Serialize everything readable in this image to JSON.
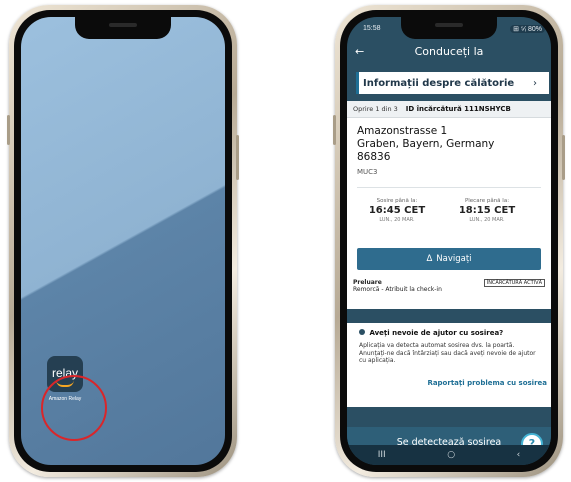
{
  "left_phone": {
    "app": {
      "icon_text": "relay",
      "label": "Amazon Relay",
      "icon_color": "#253f52",
      "accent_color": "#f5a623"
    },
    "highlight_color": "#d9262a"
  },
  "right_phone": {
    "status": {
      "time": "15:58",
      "icons": "⊞ ⁵⁄ᵢ 80%"
    },
    "header": {
      "back_icon": "←",
      "title": "Conduceți la"
    },
    "trip_info": {
      "label": "Informații despre călătorie",
      "chevron": "›"
    },
    "stop": {
      "counter": "Oprire 1 din 3",
      "load_id": "ID încărcătură 111NSHYCB",
      "address_line1": "Amazonstrasse 1",
      "address_line2": "Graben, Bayern, Germany",
      "postal": "86836",
      "facility": "MUC3"
    },
    "arrival": {
      "label": "Sosire până la:",
      "time": "16:45 CET",
      "date": "LUN., 20 MAR."
    },
    "departure": {
      "label": "Plecare până la:",
      "time": "18:15 CET",
      "date": "LUN., 20 MAR."
    },
    "navigate_button": {
      "icon": "Δ",
      "label": "Navigați"
    },
    "pickup": {
      "title": "Preluare",
      "detail": "Remorcă - Atribuit la check-in",
      "badge": "ÎNCĂRCĂTURĂ ACTIVĂ"
    },
    "help": {
      "question": "Aveți nevoie de ajutor cu sosirea?",
      "body": "Aplicația va detecta automat sosirea dvs. la poartă. Anunțați-ne dacă întârziați sau dacă aveți nevoie de ajutor cu aplicația.",
      "link": "Raportați problema cu sosirea"
    },
    "arrival_detect_button": "Se detectează sosirea",
    "help_fab": "?",
    "nav": {
      "recent": "III",
      "home": "○",
      "back": "‹"
    }
  }
}
